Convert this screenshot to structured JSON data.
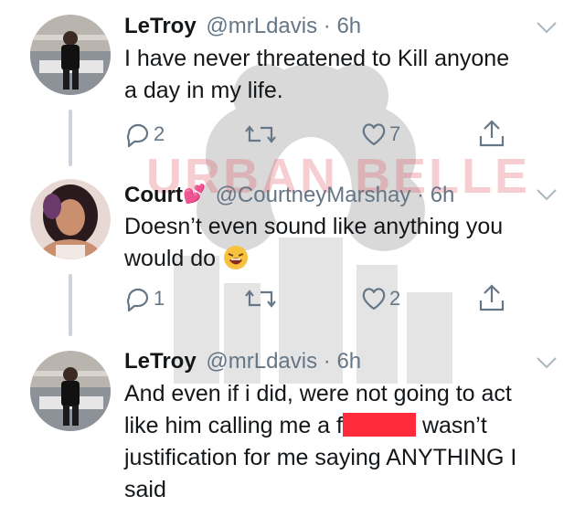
{
  "watermark": {
    "text": "URBAN BELLE"
  },
  "tweets": [
    {
      "name": "LeTroy",
      "handle": "@mrLdavis",
      "sep": "·",
      "time": "6h",
      "text_line1": "I have never threatened to Kill anyone",
      "text_line2": "a day in my life.",
      "reply_count": "2",
      "retweet_count": "",
      "like_count": "7"
    },
    {
      "name": "Court",
      "name_emoji": "💕",
      "handle": "@CourtneyMarshay",
      "sep": "·",
      "time": "6h",
      "text_line1": "Doesn’t even sound like anything you",
      "text_line2": "would do",
      "reply_count": "1",
      "retweet_count": "",
      "like_count": "2"
    },
    {
      "name": "LeTroy",
      "handle": "@mrLdavis",
      "sep": "·",
      "time": "6h",
      "text_line1": "And even if i did, were not going to act",
      "text_line2_a": "like him calling me a f",
      "text_line2_b": "wasn’t",
      "text_line3": "justification for me saying ANYTHING I",
      "text_line4": "said"
    }
  ],
  "icons": {
    "reply": "reply-icon",
    "retweet": "retweet-icon",
    "like": "heart-icon",
    "share": "share-icon",
    "caret": "chevron-down-icon"
  },
  "colors": {
    "text": "#14171a",
    "secondary": "#657786",
    "thread_line": "#cdd3d8",
    "redaction": "#ff2a3a"
  }
}
